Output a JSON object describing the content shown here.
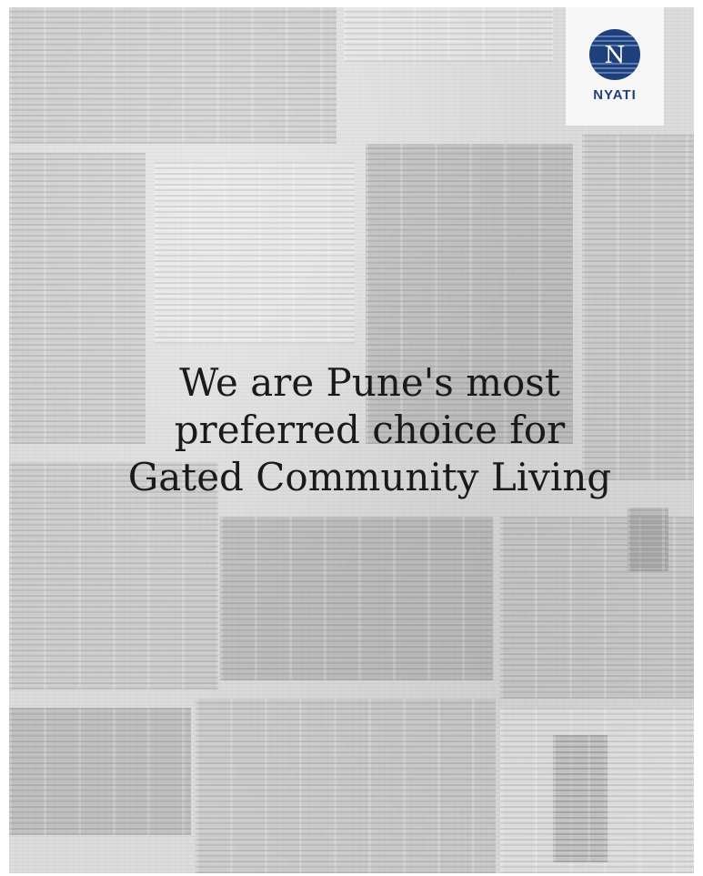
{
  "brand": {
    "logo_letter": "N",
    "logo_word": "NYATI",
    "logo_color": "#1e3f7a"
  },
  "headline": {
    "lines": [
      "We are Pune's most",
      "preferred choice for",
      "Gated Community Living"
    ],
    "color": "#1a1a1a"
  },
  "background": {
    "style": "grayscale newspaper collage",
    "base_color": "#dcdcdc"
  }
}
